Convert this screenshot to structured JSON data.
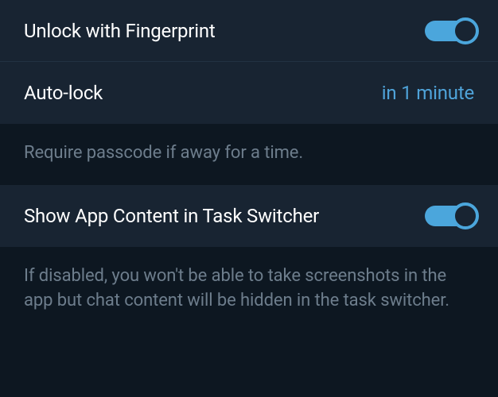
{
  "settings": {
    "fingerprint": {
      "label": "Unlock with Fingerprint",
      "enabled": true
    },
    "autolock": {
      "label": "Auto-lock",
      "value": "in 1 minute",
      "description": "Require passcode if away for a time."
    },
    "taskSwitcher": {
      "label": "Show App Content in Task Switcher",
      "enabled": true,
      "description": "If disabled, you won't be able to take screenshots in the app but chat content will be hidden in the task switcher."
    }
  }
}
